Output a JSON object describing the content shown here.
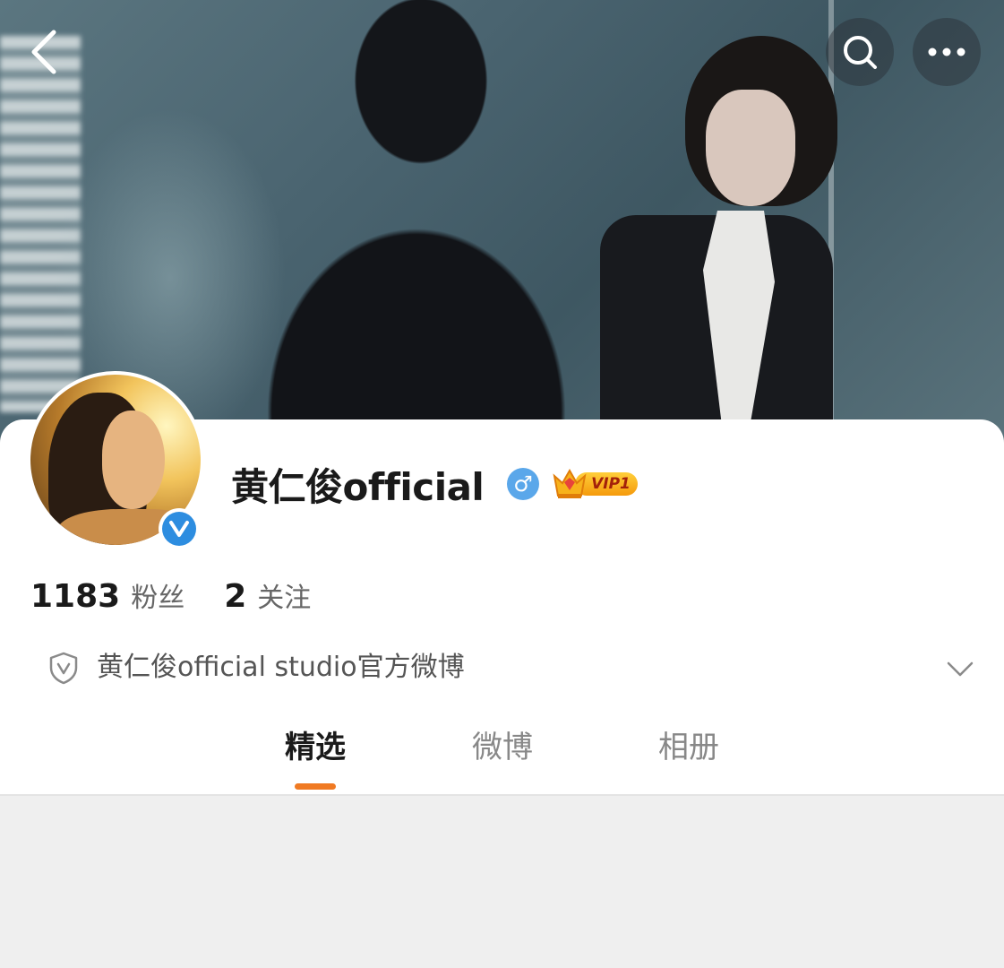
{
  "header": {
    "back_icon": "chevron-left-icon",
    "search_icon": "search-icon",
    "more_icon": "more-horizontal-icon"
  },
  "profile": {
    "username": "黄仁俊official",
    "gender_symbol": "♂",
    "vip_label": "VIP1",
    "verified_icon": "verified-v-icon",
    "verified_letter": "V"
  },
  "stats": {
    "followers_count": "1183",
    "followers_label": "粉丝",
    "following_count": "2",
    "following_label": "关注"
  },
  "description": {
    "text": "黄仁俊official studio官方微博",
    "icon": "shield-v-icon",
    "expand_icon": "chevron-down-icon"
  },
  "tabs": [
    {
      "label": "精选",
      "active": true
    },
    {
      "label": "微博",
      "active": false
    },
    {
      "label": "相册",
      "active": false
    }
  ],
  "colors": {
    "accent": "#f07a23",
    "verified_blue": "#2d8de0",
    "gender_blue": "#5aa7ea",
    "vip_gold": "#f5a623"
  }
}
